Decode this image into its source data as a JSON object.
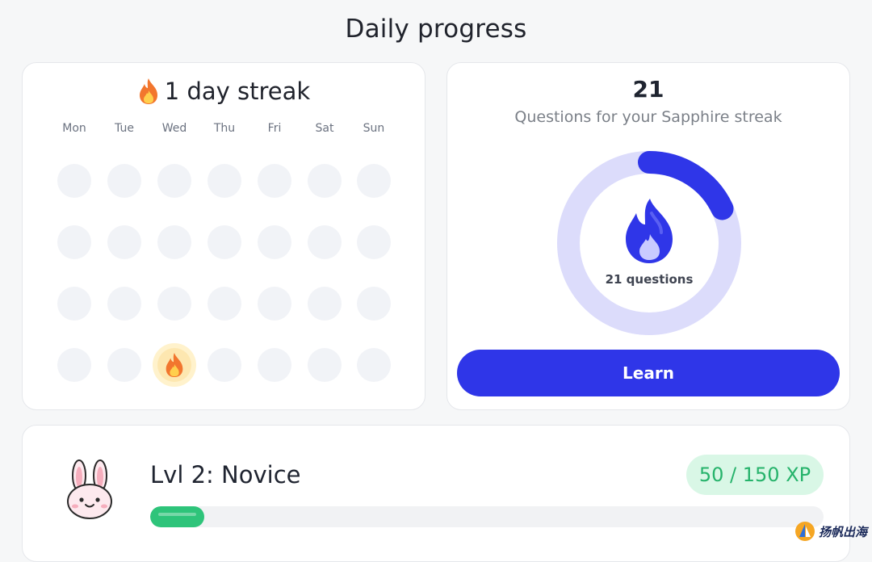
{
  "page": {
    "title": "Daily progress"
  },
  "streak": {
    "title": "1 day streak",
    "icon": "fire-icon",
    "days": [
      "Mon",
      "Tue",
      "Wed",
      "Thu",
      "Fri",
      "Sat",
      "Sun"
    ],
    "weeks": 4,
    "active_cells": [
      {
        "week": 4,
        "day": "Wed"
      }
    ],
    "colors": {
      "flame_outer": "#f2762e",
      "flame_inner": "#ffcf4d",
      "active_bg": "#fde7b0"
    }
  },
  "sapphire": {
    "count": "21",
    "subtitle": "Questions for your Sapphire streak",
    "ring_label": "21 questions",
    "progress_fraction": 0.18,
    "icon": "sapphire-flame-icon",
    "learn_label": "Learn",
    "colors": {
      "accent": "#2f36e8",
      "ring_track": "#dcdcfb"
    }
  },
  "level": {
    "title": "Lvl 2: Novice",
    "xp_label": "50 / 150 XP",
    "xp_current": 50,
    "xp_total": 150,
    "progress_fraction": 0.0805,
    "avatar": "bunny-avatar-icon",
    "colors": {
      "progress": "#2ec47a",
      "xp_bg": "#d9f7e6",
      "xp_text": "#26b36b"
    }
  },
  "watermark": {
    "text": "扬帆出海"
  }
}
